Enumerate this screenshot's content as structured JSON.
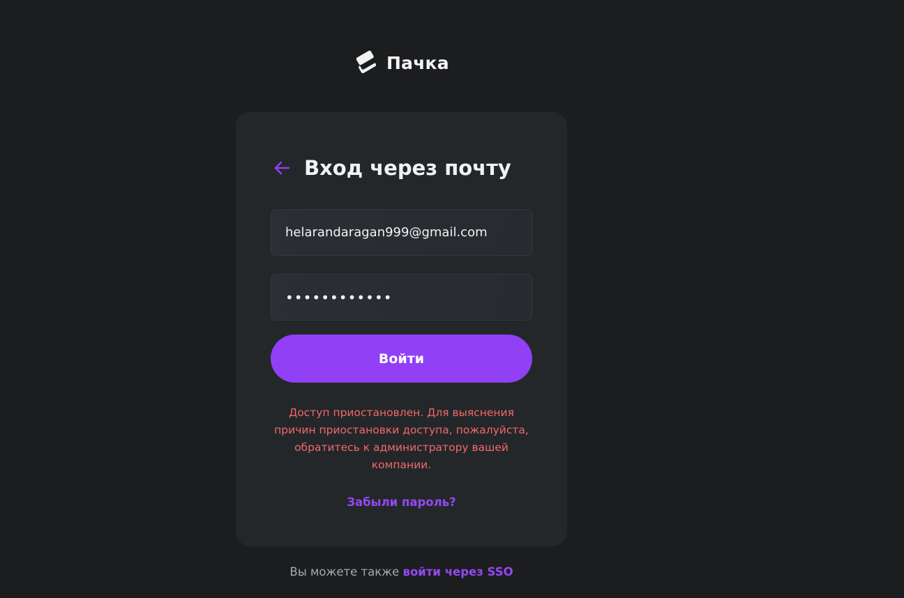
{
  "brand": {
    "name": "Пачка",
    "logo_icon": "stack-cards-icon"
  },
  "login": {
    "back_icon": "arrow-left-icon",
    "title": "Вход через почту",
    "email_value": "helarandaragan999@gmail.com",
    "password_value": "password1234",
    "submit_label": "Войти",
    "error_message": "Доступ приостановлен. Для выяснения причин приостановки доступа, пожалуйста, обратитесь к администратору вашей компании.",
    "forgot_password_label": "Забыли пароль?"
  },
  "footer": {
    "prefix_text": "Вы можете также",
    "sso_link_label": "войти через SSO"
  },
  "colors": {
    "background": "#1b1d1f",
    "card": "#24272a",
    "accent": "#9140f5",
    "error": "#f2686a"
  }
}
